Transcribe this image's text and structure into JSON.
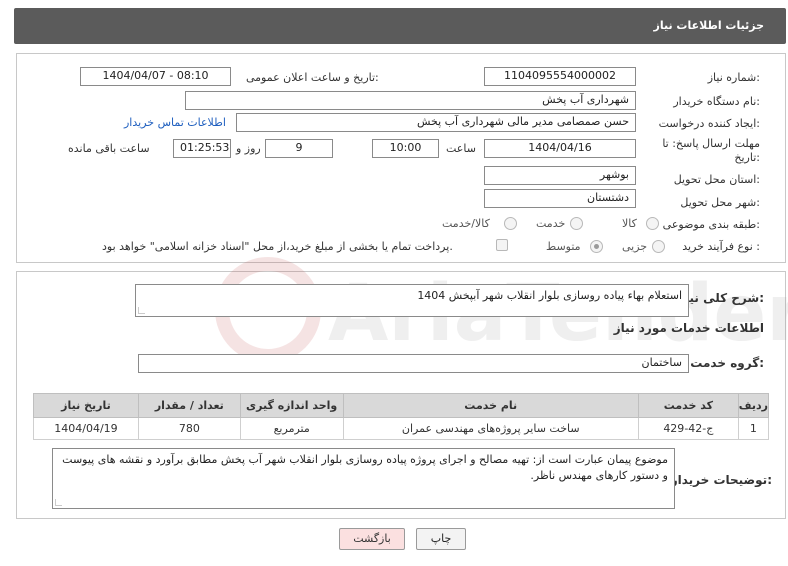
{
  "header": {
    "title": "جزئیات اطلاعات نیاز"
  },
  "form": {
    "need_number_label": "شماره نیاز:",
    "need_number": "1104095554000002",
    "announce_label": "تاریخ و ساعت اعلان عمومی:",
    "announce_value": "1404/04/07 - 08:10",
    "buyer_org_label": "نام دستگاه خریدار:",
    "buyer_org": "شهرداری آب پخش",
    "creator_label": "ایجاد کننده درخواست:",
    "creator": "حسن صمصامی مدیر مالی شهرداری آب پخش",
    "contact_link": "اطلاعات تماس خریدار",
    "deadline_label_1": "مهلت ارسال پاسخ: تا",
    "deadline_label_2": "تاریخ:",
    "deadline_date": "1404/04/16",
    "time_label": "ساعت",
    "deadline_time": "10:00",
    "days": "9",
    "days_label": "روز و",
    "remaining": "01:25:53",
    "remaining_label": "ساعت باقی مانده",
    "province_label": "استان محل تحویل:",
    "province": "بوشهر",
    "city_label": "شهر محل تحویل:",
    "city": "دشتستان",
    "category_label": "طبقه بندی موضوعی:",
    "category_options": [
      "کالا",
      "خدمت",
      "کالا/خدمت"
    ],
    "process_label": "نوع فرآیند خرید :",
    "process_options": [
      "جزیی",
      "متوسط"
    ],
    "payment_note": "پرداخت تمام یا بخشی از مبلغ خرید،از محل \"اسناد خزانه اسلامی\" خواهد بود."
  },
  "summary": {
    "label": "شرح کلی نیاز:",
    "text": "استعلام بهاء پیاده روسازی بلوار انقلاب شهر آبپخش 1404"
  },
  "services": {
    "section_title": "اطلاعات خدمات مورد نیاز",
    "group_label": "گروه خدمت:",
    "group_value": "ساختمان",
    "columns": [
      "ردیف",
      "کد خدمت",
      "نام خدمت",
      "واحد اندازه گیری",
      "تعداد / مقدار",
      "تاریخ نیاز"
    ],
    "rows": [
      {
        "row": "1",
        "code": "ج-42-429",
        "name": "ساخت سایر پروژه‌های مهندسی عمران",
        "unit": "مترمربع",
        "qty": "780",
        "date": "1404/04/19"
      }
    ]
  },
  "buyer_notes": {
    "label": "توضیحات خریدار:",
    "text": "موضوع پیمان عبارت است از: تهیه مصالح و اجرای پروژه پیاده روسازی بلوار انقلاب شهر آب پخش مطابق برآورد و نقشه های پیوست و دستور کارهای مهندس ناظر."
  },
  "buttons": {
    "print": "چاپ",
    "back": "بازگشت"
  },
  "watermark": {
    "text": "AriaTender.neT"
  },
  "colors": {
    "header_bg": "#5b5b5b",
    "link": "#1f5fbf",
    "back_btn": "#fbe0e0",
    "table_header": "#d9d9d9"
  }
}
